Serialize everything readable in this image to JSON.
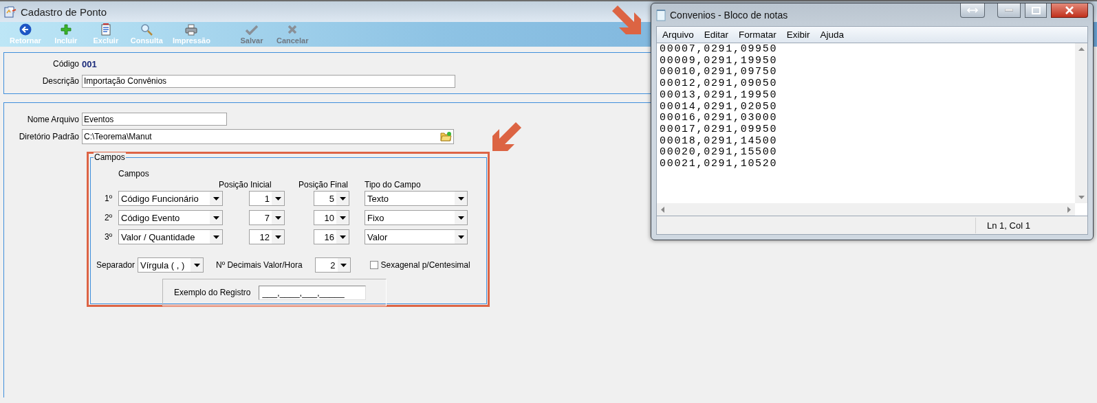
{
  "window": {
    "title": "Cadastro de Ponto"
  },
  "toolbar": [
    {
      "label": "Retornar",
      "kind": "back",
      "disabled": false
    },
    {
      "label": "Incluir",
      "kind": "add",
      "disabled": false
    },
    {
      "label": "Excluir",
      "kind": "delete",
      "disabled": false
    },
    {
      "label": "Consulta",
      "kind": "search",
      "disabled": false
    },
    {
      "label": "Impressão",
      "kind": "print",
      "disabled": false
    },
    {
      "label": "Salvar",
      "kind": "save",
      "disabled": true
    },
    {
      "label": "Cancelar",
      "kind": "cancel",
      "disabled": true
    }
  ],
  "header": {
    "codigo_label": "Código",
    "codigo_value": "001",
    "descricao_label": "Descrição",
    "descricao_value": "Importação Convênios"
  },
  "file": {
    "nome_label": "Nome Arquivo",
    "nome_value": "Eventos",
    "diretorio_label": "Diretório Padrão",
    "diretorio_value": "C:\\Teorema\\Manut"
  },
  "campos": {
    "legend": "Campos",
    "columns": [
      "Campos",
      "Posição Inicial",
      "Posição Final",
      "Tipo do Campo"
    ],
    "rows": [
      {
        "ordinal": "1º",
        "campo": "Código Funcionário",
        "inicial": "1",
        "final": "5",
        "tipo": "Texto"
      },
      {
        "ordinal": "2º",
        "campo": "Código Evento",
        "inicial": "7",
        "final": "10",
        "tipo": "Fixo"
      },
      {
        "ordinal": "3º",
        "campo": "Valor / Quantidade",
        "inicial": "12",
        "final": "16",
        "tipo": "Valor"
      }
    ],
    "separador_label": "Separador",
    "separador_value": "Vírgula ( , )",
    "decimais_label": "Nº Decimais Valor/Hora",
    "decimais_value": "2",
    "sexagenal": {
      "label": "Sexagenal p/Centesimal",
      "checked": false
    },
    "exemplo_label": "Exemplo do Registro",
    "exemplo_value": "___,____,___,_____"
  },
  "notepad": {
    "title": "Convenios - Bloco de notas",
    "menu": [
      "Arquivo",
      "Editar",
      "Formatar",
      "Exibir",
      "Ajuda"
    ],
    "lines": [
      "00007,0291,09950",
      "00009,0291,19950",
      "00010,0291,09750",
      "00012,0291,09050",
      "00013,0291,19950",
      "00014,0291,02050",
      "00016,0291,03000",
      "00017,0291,09950",
      "00018,0291,14500",
      "00020,0291,15500",
      "00021,0291,10520"
    ],
    "status": "Ln 1, Col 1"
  }
}
